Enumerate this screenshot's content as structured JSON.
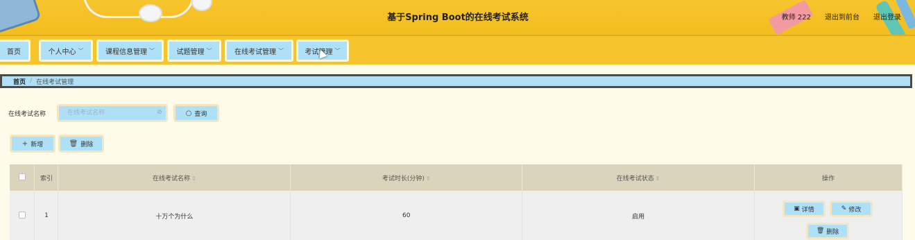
{
  "header": {
    "title": "基于Spring Boot的在线考试系统",
    "links": [
      "教师 222",
      "退出到前台",
      "退出登录"
    ]
  },
  "nav": {
    "items": [
      {
        "label": "首页",
        "has_dropdown": false
      },
      {
        "label": "个人中心",
        "has_dropdown": true
      },
      {
        "label": "课程信息管理",
        "has_dropdown": true
      },
      {
        "label": "试题管理",
        "has_dropdown": true
      },
      {
        "label": "在线考试管理",
        "has_dropdown": true
      },
      {
        "label": "考试管理",
        "has_dropdown": true
      }
    ]
  },
  "breadcrumb": {
    "home": "首页",
    "separator": "/",
    "current": "在线考试管理"
  },
  "search": {
    "label": "在线考试名称",
    "placeholder": "在线考试名称",
    "button": "查询"
  },
  "actions": {
    "add": "新增",
    "delete": "删除"
  },
  "table": {
    "columns": [
      "索引",
      "在线考试名称",
      "考试时长(分钟)",
      "在线考试状态",
      "操作"
    ],
    "rows": [
      {
        "index": "1",
        "name": "十万个为什么",
        "duration": "60",
        "status": "启用"
      }
    ],
    "row_actions": {
      "detail": "详情",
      "edit": "修改",
      "delete": "删除"
    }
  },
  "colors": {
    "header_bg": "#f7c52d",
    "button_bg": "#aee0f8",
    "page_bg": "#fffbea",
    "table_header_bg": "#d9d4bb"
  }
}
